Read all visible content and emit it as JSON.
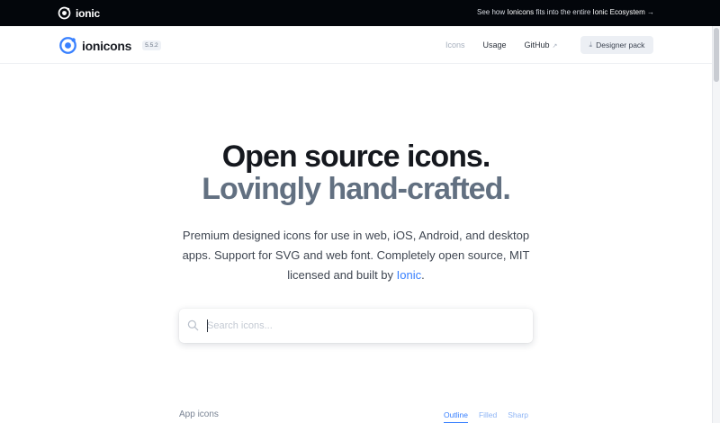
{
  "topbar": {
    "logo_text": "ionic",
    "eco_prefix": "See how ",
    "eco_strong1": "Ionicons",
    "eco_mid": " fits into the entire ",
    "eco_strong2": "Ionic Ecosystem",
    "eco_arrow": "→"
  },
  "nav": {
    "brand_name": "ionicons",
    "version": "5.5.2",
    "links": [
      {
        "label": "Icons"
      },
      {
        "label": "Usage"
      },
      {
        "label": "GitHub"
      }
    ],
    "external_icon": "↗",
    "designer_button": "Designer pack",
    "download_icon": "⤓"
  },
  "hero": {
    "title_line1": "Open source icons.",
    "title_line2": "Lovingly hand-crafted.",
    "desc_text": "Premium designed icons for use in web, iOS, Android, and desktop apps. Support for SVG and web font. Completely open source, MIT licensed and built by ",
    "desc_link": "Ionic",
    "desc_end": "."
  },
  "search": {
    "placeholder": "Search icons...",
    "value": ""
  },
  "section": {
    "title": "App icons",
    "tabs": [
      {
        "label": "Outline",
        "active": true
      },
      {
        "label": "Filled",
        "active": false
      },
      {
        "label": "Sharp",
        "active": false
      }
    ]
  },
  "colors": {
    "accent": "#3880ff",
    "topbar_bg": "#03060b",
    "title_dark": "#15181e",
    "title_slate": "#627081"
  },
  "icons": {
    "ionic_logo": "ionic-logo-icon",
    "brand": "ionicons-logo-icon",
    "search": "search-icon"
  }
}
